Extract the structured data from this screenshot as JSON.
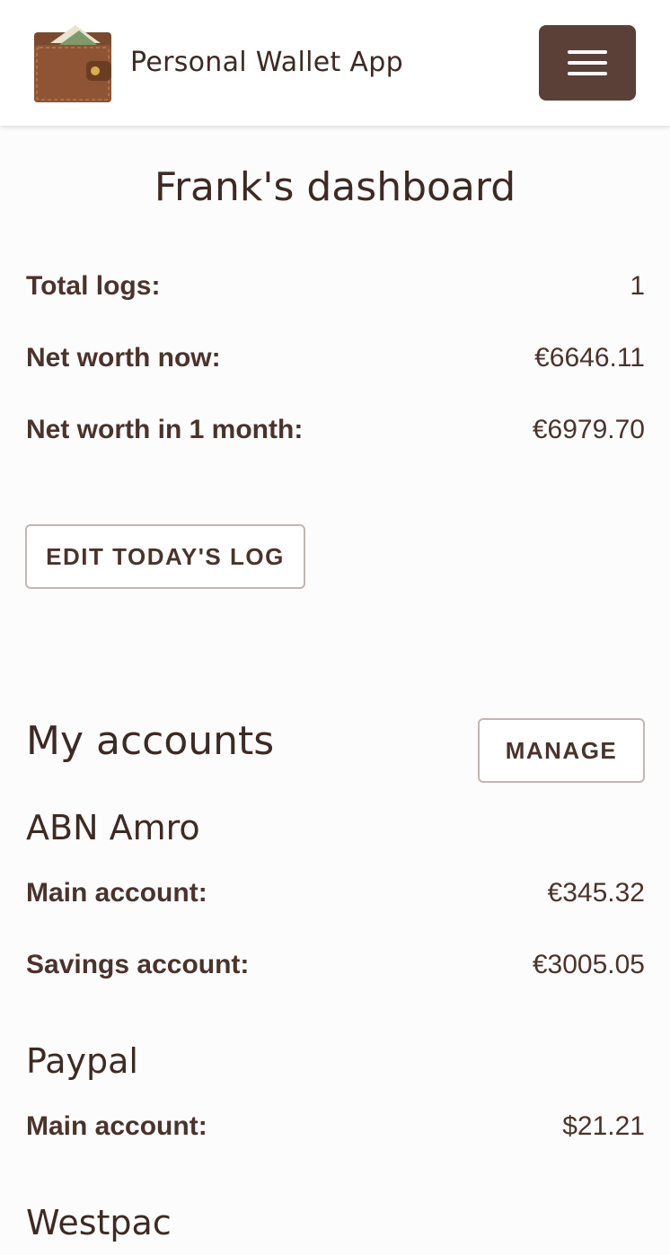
{
  "header": {
    "app_title": "Personal Wallet App",
    "logo_icon": "wallet-icon",
    "menu_icon": "hamburger-icon"
  },
  "dashboard": {
    "title": "Frank's dashboard",
    "stats": [
      {
        "label": "Total logs:",
        "value": "1"
      },
      {
        "label": "Net worth now:",
        "value": "€6646.11"
      },
      {
        "label": "Net worth in 1 month:",
        "value": "€6979.70"
      }
    ],
    "edit_log_label": "EDIT TODAY'S LOG"
  },
  "accounts": {
    "title": "My accounts",
    "manage_label": "MANAGE",
    "banks": [
      {
        "name": "ABN Amro",
        "accounts": [
          {
            "label": "Main account:",
            "value": "€345.32"
          },
          {
            "label": "Savings account:",
            "value": "€3005.05"
          }
        ]
      },
      {
        "name": "Paypal",
        "accounts": [
          {
            "label": "Main account:",
            "value": "$21.21"
          }
        ]
      },
      {
        "name": "Westpac",
        "accounts": []
      }
    ]
  },
  "colors": {
    "text": "#4a332b",
    "heading": "#3d2a23",
    "menu_button": "#5b4037",
    "background": "#fdfcfc",
    "button_border": "#bfb7b3"
  }
}
